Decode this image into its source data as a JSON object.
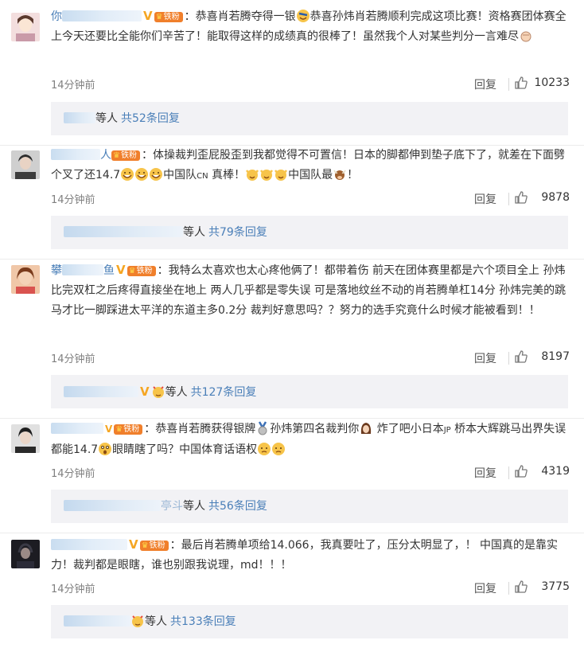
{
  "colors": {
    "link": "#4a7fb8",
    "badge": "#f07f2b",
    "vip": "#f5a623",
    "reply_bg": "#f2f2f5"
  },
  "fan_badge_label": "铁粉",
  "vip_mark": "V",
  "reply_label": "回复",
  "comments": [
    {
      "user_prefix": "你",
      "time": "14分钟前",
      "likes": "10233",
      "text": [
        "：恭喜肖若腾夺得一银",
        "恭喜孙炜肖若腾顺利完成这项比赛！资格赛团体赛全上今天还要比全能你们辛苦了！能取得这样的成绩真的很棒了！虽然我个人对某些判分一言难尽"
      ],
      "replies": {
        "suffix": "等人",
        "count_label": "共52条回复"
      }
    },
    {
      "user_prefix": "",
      "user_suffix": "人",
      "time": "14分钟前",
      "likes": "9878",
      "text": [
        "：体操裁判歪屁股歪到我都觉得不可置信！日本的脚都伸到垫子底下了，就差在下面劈个叉了还14.7",
        "中国队",
        "CN",
        " 真棒！",
        "中国队最",
        "！"
      ],
      "replies": {
        "suffix": "等人",
        "count_label": "共79条回复"
      }
    },
    {
      "user_prefix": "攀",
      "user_suffix": "鱼",
      "time": "14分钟前",
      "likes": "8197",
      "text": [
        "：我特么太喜欢也太心疼他俩了！都带着伤 前天在团体赛里都是六个项目全上  孙炜比完双杠之后疼得直接坐在地上  两人几乎都是零失误 可是落地纹丝不动的肖若腾单杠14分 孙炜完美的跳马才比一脚踩进太平洋的东道主多0.2分 裁判好意思吗？？努力的选手究竟什么时候才能被看到！！"
      ],
      "replies": {
        "suffix": "等人",
        "count_label": "共127条回复"
      }
    },
    {
      "user_prefix": "",
      "time": "14分钟前",
      "likes": "4319",
      "text": [
        "：恭喜肖若腾获得银牌",
        "孙炜第四名裁判你",
        " 炸了吧小日本",
        "JP",
        " 桥本大辉跳马出界失误都能14.7",
        "眼睛瞎了吗？中国体育话语权"
      ],
      "replies": {
        "middle": "亭斗",
        "suffix": "等人",
        "count_label": "共56条回复"
      }
    },
    {
      "user_prefix": "",
      "time": "14分钟前",
      "likes": "3775",
      "text": [
        "：最后肖若腾单项给14.066，我真要吐了，压分太明显了，！ 中国真的是靠实力！裁判都是眼瞎，谁也别跟我说理，md！！！"
      ],
      "replies": {
        "suffix": "等人",
        "count_label": "共133条回复"
      }
    }
  ]
}
